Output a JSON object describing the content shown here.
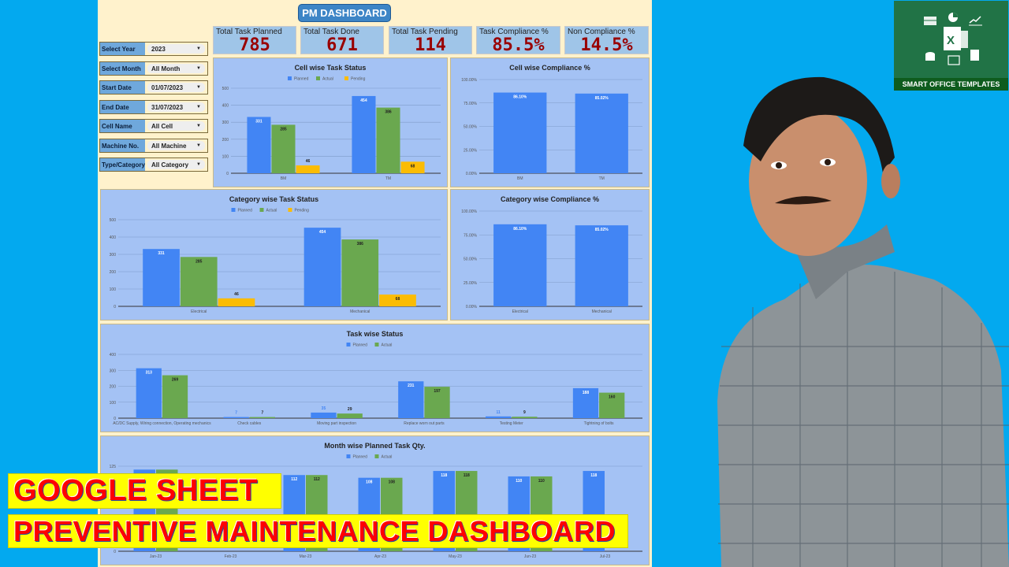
{
  "dashboard": {
    "title_button": "PM DASHBOARD"
  },
  "kpis": [
    {
      "label": "Total Task Planned",
      "value": "785"
    },
    {
      "label": "Total Task Done",
      "value": "671"
    },
    {
      "label": "Total Task Pending",
      "value": "114"
    },
    {
      "label": "Task Compliance %",
      "value": "85.5%"
    },
    {
      "label": "Non Compliance %",
      "value": "14.5%"
    }
  ],
  "filters": [
    {
      "label": "Select Year",
      "value": "2023"
    },
    {
      "label": "Select Month",
      "value": "All Month"
    },
    {
      "label": "Start Date",
      "value": "01/07/2023"
    },
    {
      "label": "End Date",
      "value": "31/07/2023"
    },
    {
      "label": "Cell Name",
      "value": "All Cell"
    },
    {
      "label": "Machine No.",
      "value": "All Machine"
    },
    {
      "label": "Type/Category",
      "value": "All Category"
    }
  ],
  "colors": {
    "planned": "#4285f4",
    "actual": "#6aa84f",
    "pending": "#fbbc04",
    "kpi_value": "#990000",
    "panel_bg": "#a4c2f4"
  },
  "chart_data": [
    {
      "id": "cell_task",
      "type": "bar",
      "title": "Cell wise Task Status",
      "categories": [
        "BM",
        "TM"
      ],
      "series": [
        {
          "name": "Planned",
          "values": [
            331,
            454
          ]
        },
        {
          "name": "Actual",
          "values": [
            285,
            386
          ]
        },
        {
          "name": "Pending",
          "values": [
            46,
            68
          ]
        }
      ],
      "yticks": [
        "0",
        "100",
        "200",
        "300",
        "400",
        "500"
      ],
      "ylim": [
        0,
        500
      ],
      "legend": "top",
      "grid": true
    },
    {
      "id": "cell_compliance",
      "type": "bar",
      "title": "Cell wise Compliance %",
      "categories": [
        "BM",
        "TM"
      ],
      "series": [
        {
          "name": "Compliance",
          "values": [
            86.1,
            85.02
          ],
          "labels": [
            "86.10%",
            "85.02%"
          ]
        }
      ],
      "yticks": [
        "0.00%",
        "25.00%",
        "50.00%",
        "75.00%",
        "100.00%"
      ],
      "ylim": [
        0,
        100
      ],
      "legend": "none",
      "grid": true
    },
    {
      "id": "category_task",
      "type": "bar",
      "title": "Category wise Task Status",
      "categories": [
        "Electrical",
        "Mechanical"
      ],
      "series": [
        {
          "name": "Planned",
          "values": [
            331,
            454
          ]
        },
        {
          "name": "Actual",
          "values": [
            285,
            386
          ]
        },
        {
          "name": "Pending",
          "values": [
            46,
            68
          ]
        }
      ],
      "yticks": [
        "0",
        "100",
        "200",
        "300",
        "400",
        "500"
      ],
      "ylim": [
        0,
        500
      ],
      "legend": "top",
      "grid": true
    },
    {
      "id": "category_compliance",
      "type": "bar",
      "title": "Category wise Compliance %",
      "categories": [
        "Electrical",
        "Mechanical"
      ],
      "series": [
        {
          "name": "Compliance",
          "values": [
            86.1,
            85.02
          ],
          "labels": [
            "86.10%",
            "85.02%"
          ]
        }
      ],
      "yticks": [
        "0.00%",
        "25.00%",
        "50.00%",
        "75.00%",
        "100.00%"
      ],
      "ylim": [
        0,
        100
      ],
      "legend": "none",
      "grid": true
    },
    {
      "id": "task_status",
      "type": "bar",
      "title": "Task  wise Status",
      "categories": [
        "AC/DC Supply, Wiring connection, Operating mechanics",
        "Check cables",
        "Moving part inspection",
        "Replace worn out parts",
        "Testing Meter",
        "Tightning of bolts"
      ],
      "series": [
        {
          "name": "Planned",
          "values": [
            313,
            7,
            35,
            231,
            11,
            188
          ]
        },
        {
          "name": "Actual",
          "values": [
            269,
            7,
            29,
            197,
            9,
            160
          ]
        }
      ],
      "yticks": [
        "0",
        "100",
        "200",
        "300",
        "400"
      ],
      "ylim": [
        0,
        400
      ],
      "legend": "top",
      "grid": true
    },
    {
      "id": "month_planned",
      "type": "bar",
      "title": "Month wise Planned Task Qty.",
      "categories": [
        "Jan-23",
        "Feb-23",
        "Mar-23",
        "Apr-23",
        "May-23",
        "Jun-23",
        "Jul-23"
      ],
      "series": [
        {
          "name": "Planned",
          "values": [
            120,
            null,
            112,
            108,
            118,
            110,
            118
          ],
          "labels": [
            "",
            "",
            "112",
            "108",
            "118",
            "110",
            "118"
          ]
        },
        {
          "name": "Actual",
          "values": [
            120,
            null,
            112,
            108,
            118,
            110,
            null
          ],
          "labels": [
            "",
            "",
            "112",
            "108",
            "118",
            "110",
            ""
          ]
        }
      ],
      "yticks": [
        "0",
        "125"
      ],
      "ylim": [
        0,
        125
      ],
      "legend": "top",
      "grid": true
    }
  ],
  "branding": {
    "logo_caption": "SMART OFFICE TEMPLATES",
    "banner_line1": "GOOGLE SHEET",
    "banner_line2": "PREVENTIVE MAINTENANCE DASHBOARD"
  }
}
